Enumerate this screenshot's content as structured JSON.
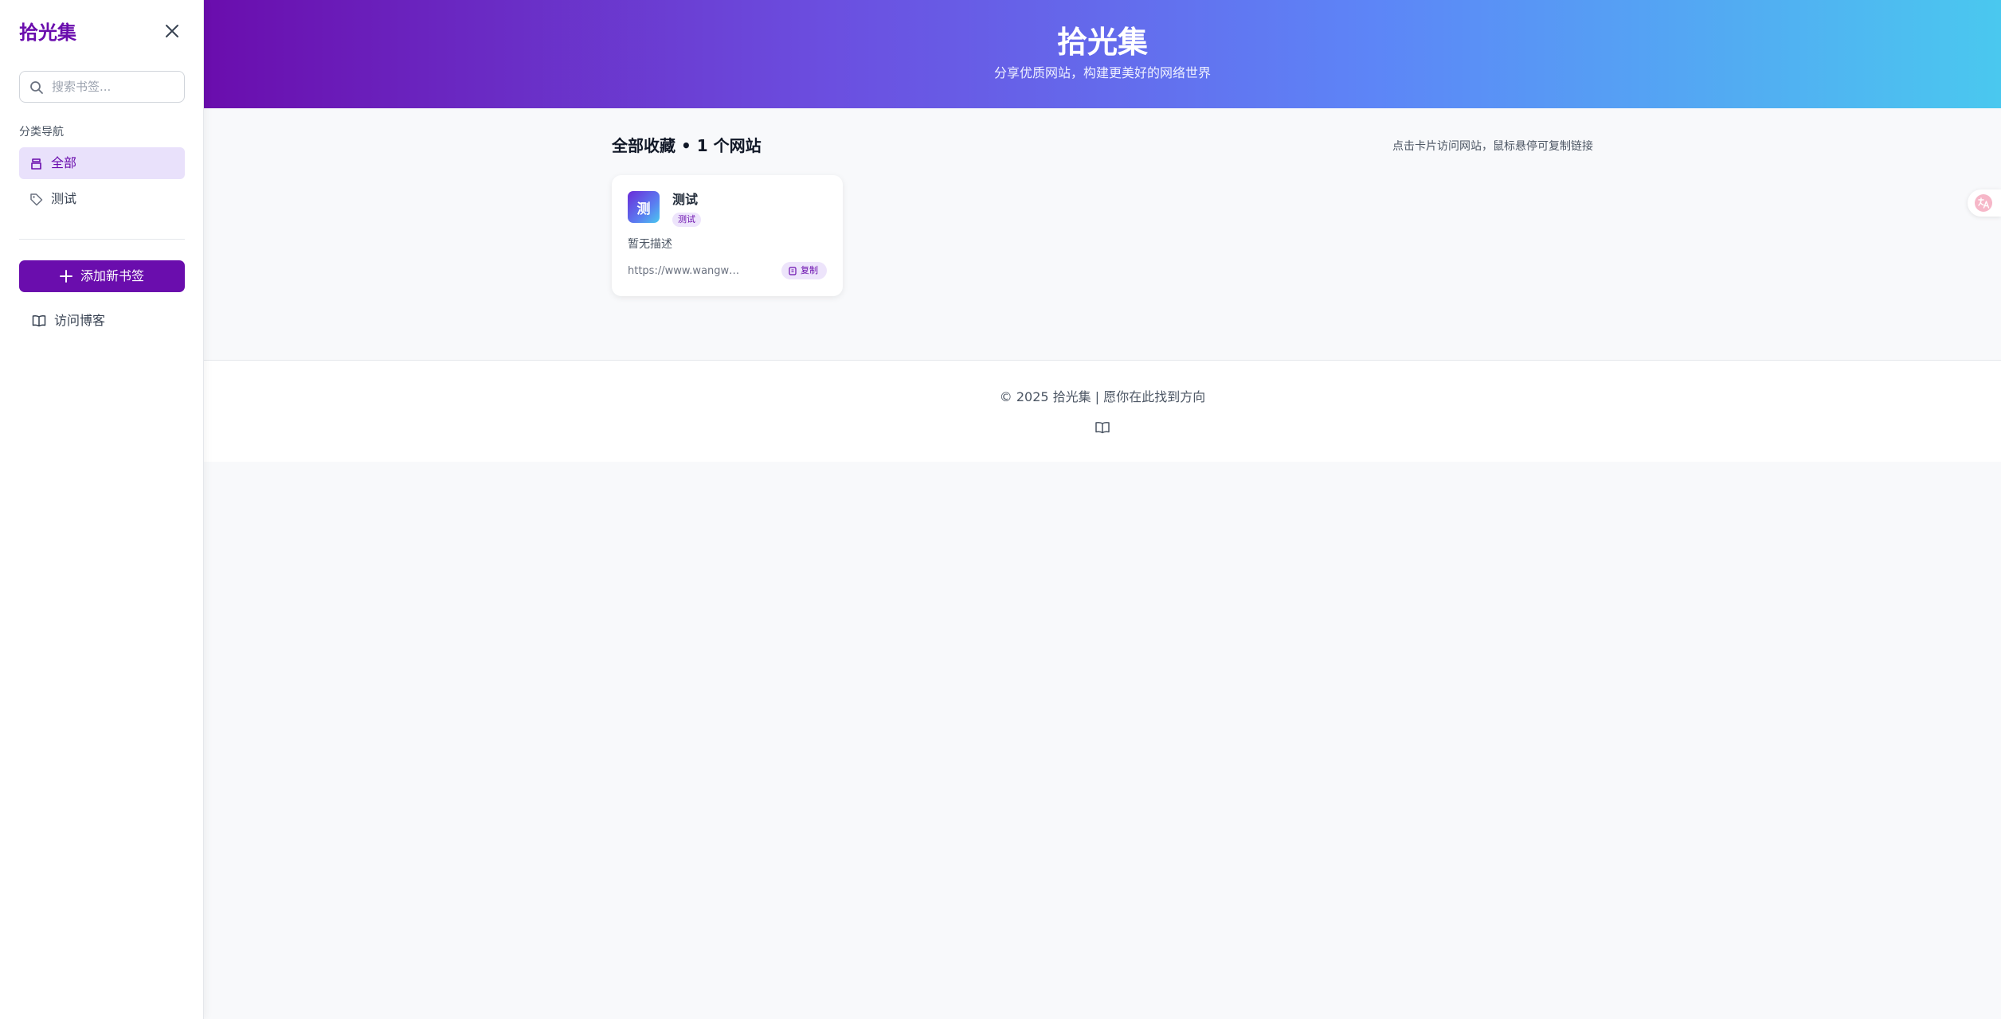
{
  "sidebar": {
    "title": "拾光集",
    "search_placeholder": "搜索书签...",
    "section_label": "分类导航",
    "nav_items": [
      {
        "label": "全部",
        "icon": "bookmark-stack-icon",
        "active": true
      },
      {
        "label": "测试",
        "icon": "tag-icon",
        "active": false
      }
    ],
    "add_button_label": "添加新书签",
    "blog_link_label": "访问博客"
  },
  "header": {
    "title": "拾光集",
    "subtitle": "分享优质网站，构建更美好的网络世界"
  },
  "main": {
    "heading": "全部收藏 • 1 个网站",
    "hint": "点击卡片访问网站，鼠标悬停可复制链接",
    "cards": [
      {
        "avatar_letter": "测",
        "name": "测试",
        "tag": "测试",
        "description": "暂无描述",
        "url": "https://www.wangwan···",
        "copy_label": "复制"
      }
    ]
  },
  "footer": {
    "text": "© 2025 拾光集 | 愿你在此找到方向"
  },
  "colors": {
    "brand": "#6a0dad",
    "header_gradient_start": "#6a0dad",
    "header_gradient_end": "#4ac8ef",
    "active_nav_bg": "#e9e1fb",
    "page_bg": "#f8f9fb"
  }
}
